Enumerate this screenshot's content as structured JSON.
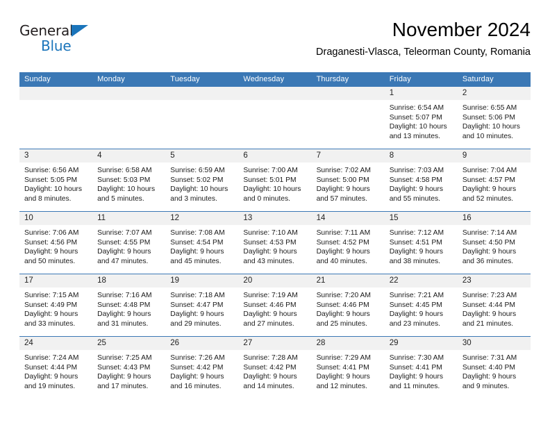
{
  "brand": {
    "name_top": "General",
    "name_bottom": "Blue",
    "triangle_color": "#1b75bb"
  },
  "header": {
    "month_title": "November 2024",
    "location": "Draganesti-Vlasca, Teleorman County, Romania"
  },
  "theme": {
    "header_blue": "#3b78b5",
    "daynum_band": "#f1f1f1",
    "week_divider": "#3b78b5"
  },
  "calendar": {
    "weekdays": [
      "Sunday",
      "Monday",
      "Tuesday",
      "Wednesday",
      "Thursday",
      "Friday",
      "Saturday"
    ],
    "weeks": [
      {
        "days": [
          {
            "num": "",
            "lines": []
          },
          {
            "num": "",
            "lines": []
          },
          {
            "num": "",
            "lines": []
          },
          {
            "num": "",
            "lines": []
          },
          {
            "num": "",
            "lines": []
          },
          {
            "num": "1",
            "lines": [
              "Sunrise: 6:54 AM",
              "Sunset: 5:07 PM",
              "Daylight: 10 hours",
              "and 13 minutes."
            ]
          },
          {
            "num": "2",
            "lines": [
              "Sunrise: 6:55 AM",
              "Sunset: 5:06 PM",
              "Daylight: 10 hours",
              "and 10 minutes."
            ]
          }
        ]
      },
      {
        "days": [
          {
            "num": "3",
            "lines": [
              "Sunrise: 6:56 AM",
              "Sunset: 5:05 PM",
              "Daylight: 10 hours",
              "and 8 minutes."
            ]
          },
          {
            "num": "4",
            "lines": [
              "Sunrise: 6:58 AM",
              "Sunset: 5:03 PM",
              "Daylight: 10 hours",
              "and 5 minutes."
            ]
          },
          {
            "num": "5",
            "lines": [
              "Sunrise: 6:59 AM",
              "Sunset: 5:02 PM",
              "Daylight: 10 hours",
              "and 3 minutes."
            ]
          },
          {
            "num": "6",
            "lines": [
              "Sunrise: 7:00 AM",
              "Sunset: 5:01 PM",
              "Daylight: 10 hours",
              "and 0 minutes."
            ]
          },
          {
            "num": "7",
            "lines": [
              "Sunrise: 7:02 AM",
              "Sunset: 5:00 PM",
              "Daylight: 9 hours",
              "and 57 minutes."
            ]
          },
          {
            "num": "8",
            "lines": [
              "Sunrise: 7:03 AM",
              "Sunset: 4:58 PM",
              "Daylight: 9 hours",
              "and 55 minutes."
            ]
          },
          {
            "num": "9",
            "lines": [
              "Sunrise: 7:04 AM",
              "Sunset: 4:57 PM",
              "Daylight: 9 hours",
              "and 52 minutes."
            ]
          }
        ]
      },
      {
        "days": [
          {
            "num": "10",
            "lines": [
              "Sunrise: 7:06 AM",
              "Sunset: 4:56 PM",
              "Daylight: 9 hours",
              "and 50 minutes."
            ]
          },
          {
            "num": "11",
            "lines": [
              "Sunrise: 7:07 AM",
              "Sunset: 4:55 PM",
              "Daylight: 9 hours",
              "and 47 minutes."
            ]
          },
          {
            "num": "12",
            "lines": [
              "Sunrise: 7:08 AM",
              "Sunset: 4:54 PM",
              "Daylight: 9 hours",
              "and 45 minutes."
            ]
          },
          {
            "num": "13",
            "lines": [
              "Sunrise: 7:10 AM",
              "Sunset: 4:53 PM",
              "Daylight: 9 hours",
              "and 43 minutes."
            ]
          },
          {
            "num": "14",
            "lines": [
              "Sunrise: 7:11 AM",
              "Sunset: 4:52 PM",
              "Daylight: 9 hours",
              "and 40 minutes."
            ]
          },
          {
            "num": "15",
            "lines": [
              "Sunrise: 7:12 AM",
              "Sunset: 4:51 PM",
              "Daylight: 9 hours",
              "and 38 minutes."
            ]
          },
          {
            "num": "16",
            "lines": [
              "Sunrise: 7:14 AM",
              "Sunset: 4:50 PM",
              "Daylight: 9 hours",
              "and 36 minutes."
            ]
          }
        ]
      },
      {
        "days": [
          {
            "num": "17",
            "lines": [
              "Sunrise: 7:15 AM",
              "Sunset: 4:49 PM",
              "Daylight: 9 hours",
              "and 33 minutes."
            ]
          },
          {
            "num": "18",
            "lines": [
              "Sunrise: 7:16 AM",
              "Sunset: 4:48 PM",
              "Daylight: 9 hours",
              "and 31 minutes."
            ]
          },
          {
            "num": "19",
            "lines": [
              "Sunrise: 7:18 AM",
              "Sunset: 4:47 PM",
              "Daylight: 9 hours",
              "and 29 minutes."
            ]
          },
          {
            "num": "20",
            "lines": [
              "Sunrise: 7:19 AM",
              "Sunset: 4:46 PM",
              "Daylight: 9 hours",
              "and 27 minutes."
            ]
          },
          {
            "num": "21",
            "lines": [
              "Sunrise: 7:20 AM",
              "Sunset: 4:46 PM",
              "Daylight: 9 hours",
              "and 25 minutes."
            ]
          },
          {
            "num": "22",
            "lines": [
              "Sunrise: 7:21 AM",
              "Sunset: 4:45 PM",
              "Daylight: 9 hours",
              "and 23 minutes."
            ]
          },
          {
            "num": "23",
            "lines": [
              "Sunrise: 7:23 AM",
              "Sunset: 4:44 PM",
              "Daylight: 9 hours",
              "and 21 minutes."
            ]
          }
        ]
      },
      {
        "days": [
          {
            "num": "24",
            "lines": [
              "Sunrise: 7:24 AM",
              "Sunset: 4:44 PM",
              "Daylight: 9 hours",
              "and 19 minutes."
            ]
          },
          {
            "num": "25",
            "lines": [
              "Sunrise: 7:25 AM",
              "Sunset: 4:43 PM",
              "Daylight: 9 hours",
              "and 17 minutes."
            ]
          },
          {
            "num": "26",
            "lines": [
              "Sunrise: 7:26 AM",
              "Sunset: 4:42 PM",
              "Daylight: 9 hours",
              "and 16 minutes."
            ]
          },
          {
            "num": "27",
            "lines": [
              "Sunrise: 7:28 AM",
              "Sunset: 4:42 PM",
              "Daylight: 9 hours",
              "and 14 minutes."
            ]
          },
          {
            "num": "28",
            "lines": [
              "Sunrise: 7:29 AM",
              "Sunset: 4:41 PM",
              "Daylight: 9 hours",
              "and 12 minutes."
            ]
          },
          {
            "num": "29",
            "lines": [
              "Sunrise: 7:30 AM",
              "Sunset: 4:41 PM",
              "Daylight: 9 hours",
              "and 11 minutes."
            ]
          },
          {
            "num": "30",
            "lines": [
              "Sunrise: 7:31 AM",
              "Sunset: 4:40 PM",
              "Daylight: 9 hours",
              "and 9 minutes."
            ]
          }
        ]
      }
    ]
  }
}
